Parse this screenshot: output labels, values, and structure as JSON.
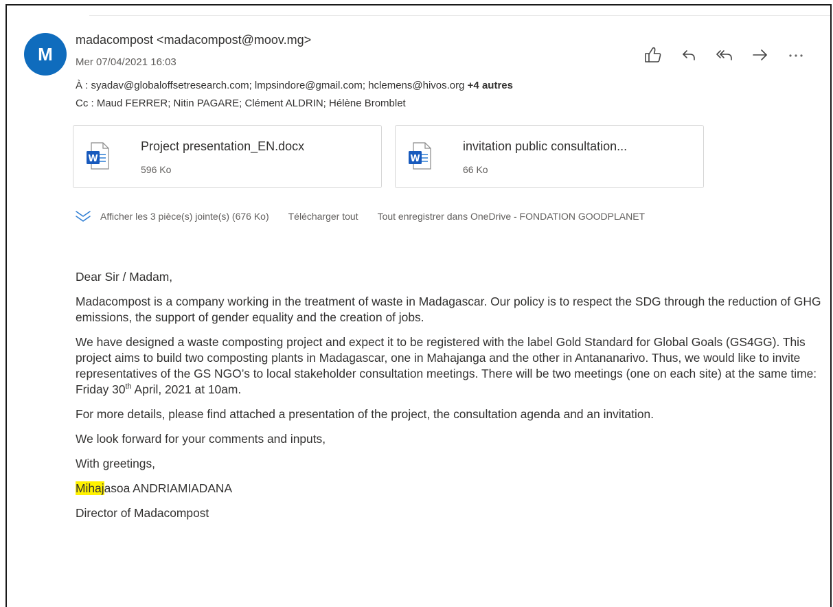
{
  "header": {
    "avatar_letter": "M",
    "sender": "madacompost <madacompost@moov.mg>",
    "date": "Mer 07/04/2021 16:03",
    "to_label": "À :",
    "to_recipients": "syadav@globaloffsetresearch.com; lmpsindore@gmail.com; hclemens@hivos.org",
    "to_more": "+4 autres",
    "cc_label": "Cc :",
    "cc_recipients": "Maud FERRER; Nitin PAGARE; Clément ALDRIN; Hélène Bromblet"
  },
  "actions": [
    {
      "name": "like",
      "icon": "thumbs-up-icon"
    },
    {
      "name": "reply",
      "icon": "reply-icon"
    },
    {
      "name": "reply-all",
      "icon": "reply-all-icon"
    },
    {
      "name": "forward",
      "icon": "forward-icon"
    },
    {
      "name": "more",
      "icon": "more-icon"
    }
  ],
  "attachments": [
    {
      "name": "Project presentation_EN.docx",
      "size": "596 Ko",
      "icon": "word-icon"
    },
    {
      "name": "invitation public consultation...",
      "size": "66 Ko",
      "icon": "word-icon"
    }
  ],
  "attachment_bar": {
    "show_all": "Afficher les 3 pièce(s) jointe(s) (676 Ko)",
    "download_all": "Télécharger tout",
    "save_all": "Tout enregistrer dans OneDrive - FONDATION GOODPLANET"
  },
  "body": {
    "greeting": "Dear Sir / Madam,",
    "p1": "Madacompost is a company working in the treatment of waste in Madagascar. Our policy is to respect the SDG through the reduction of GHG emissions, the support of gender equality and the creation of jobs.",
    "p2_main": "We have designed a waste composting project and expect it to be registered with the label Gold Standard for Global Goals (GS4GG). This project aims to build two composting plants in Madagascar, one in Mahajanga and the other in Antananarivo. Thus, we would like to invite representatives of the GS NGO’s to local stakeholder consultation meetings. There will be two meetings (one on each site) at the same time: Friday 30",
    "p2_sup": "th",
    "p2_end": " April, 2021 at 10am.",
    "p3": "For more details, please find attached a presentation of the project, the consultation agenda and an invitation.",
    "p4": "We look forward for your comments and inputs,",
    "p5": "With greetings,",
    "sig_highlight": "Mihaj",
    "sig_rest": "asoa ANDRIAMIADANA",
    "sig_title": "Director of Madacompost"
  },
  "colors": {
    "avatar": "#0f6cbd",
    "highlight": "#fff200",
    "word_blue": "#185abd"
  }
}
